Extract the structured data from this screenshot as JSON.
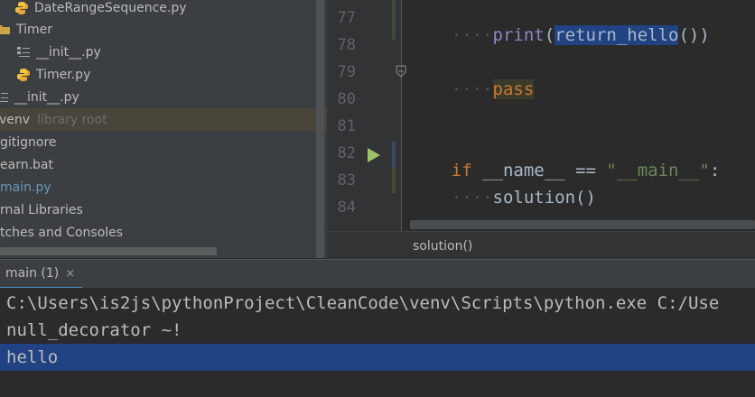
{
  "project_tree": {
    "items": [
      {
        "label": "DateRangeSequence.py",
        "type": "python-file"
      },
      {
        "label": "Timer",
        "type": "folder"
      },
      {
        "label": "__init__.py",
        "type": "init-file"
      },
      {
        "label": "Timer.py",
        "type": "python-file"
      },
      {
        "label": "__init__.py",
        "type": "init-file"
      },
      {
        "label": "venv",
        "hint": "library root",
        "type": "folder",
        "selected": true
      },
      {
        "label": "gitignore",
        "type": "file"
      },
      {
        "label": "earn.bat",
        "type": "file"
      },
      {
        "label": "main.py",
        "type": "file"
      },
      {
        "label": "rnal Libraries",
        "type": "folder"
      },
      {
        "label": "tches and Consoles",
        "type": "folder"
      }
    ]
  },
  "editor": {
    "lines": [
      {
        "num": "77"
      },
      {
        "num": "78"
      },
      {
        "num": "79"
      },
      {
        "num": "80"
      },
      {
        "num": "81"
      },
      {
        "num": "82"
      },
      {
        "num": "83"
      },
      {
        "num": "84"
      }
    ],
    "tokens": {
      "indent": "····",
      "print": "print",
      "paren_open": "(",
      "return_hello": "return_hello",
      "paren_close": "())",
      "pass": "pass",
      "if": "if",
      "name": "__name__",
      "eq": "==",
      "main_str": "\"__main__\"",
      "colon": ":",
      "solution": "solution()"
    }
  },
  "breadcrumb": {
    "label": "solution()"
  },
  "run_panel": {
    "tab_label": "main (1)",
    "close_glyph": "×",
    "lines": [
      "C:\\Users\\is2js\\pythonProject\\CleanCode\\venv\\Scripts\\python.exe C:/Use",
      "null_decorator ~!",
      "hello"
    ]
  },
  "colors": {
    "selection": "#214283",
    "keyword": "#cc7832",
    "string": "#6a8759",
    "builtin": "#8888c6"
  }
}
